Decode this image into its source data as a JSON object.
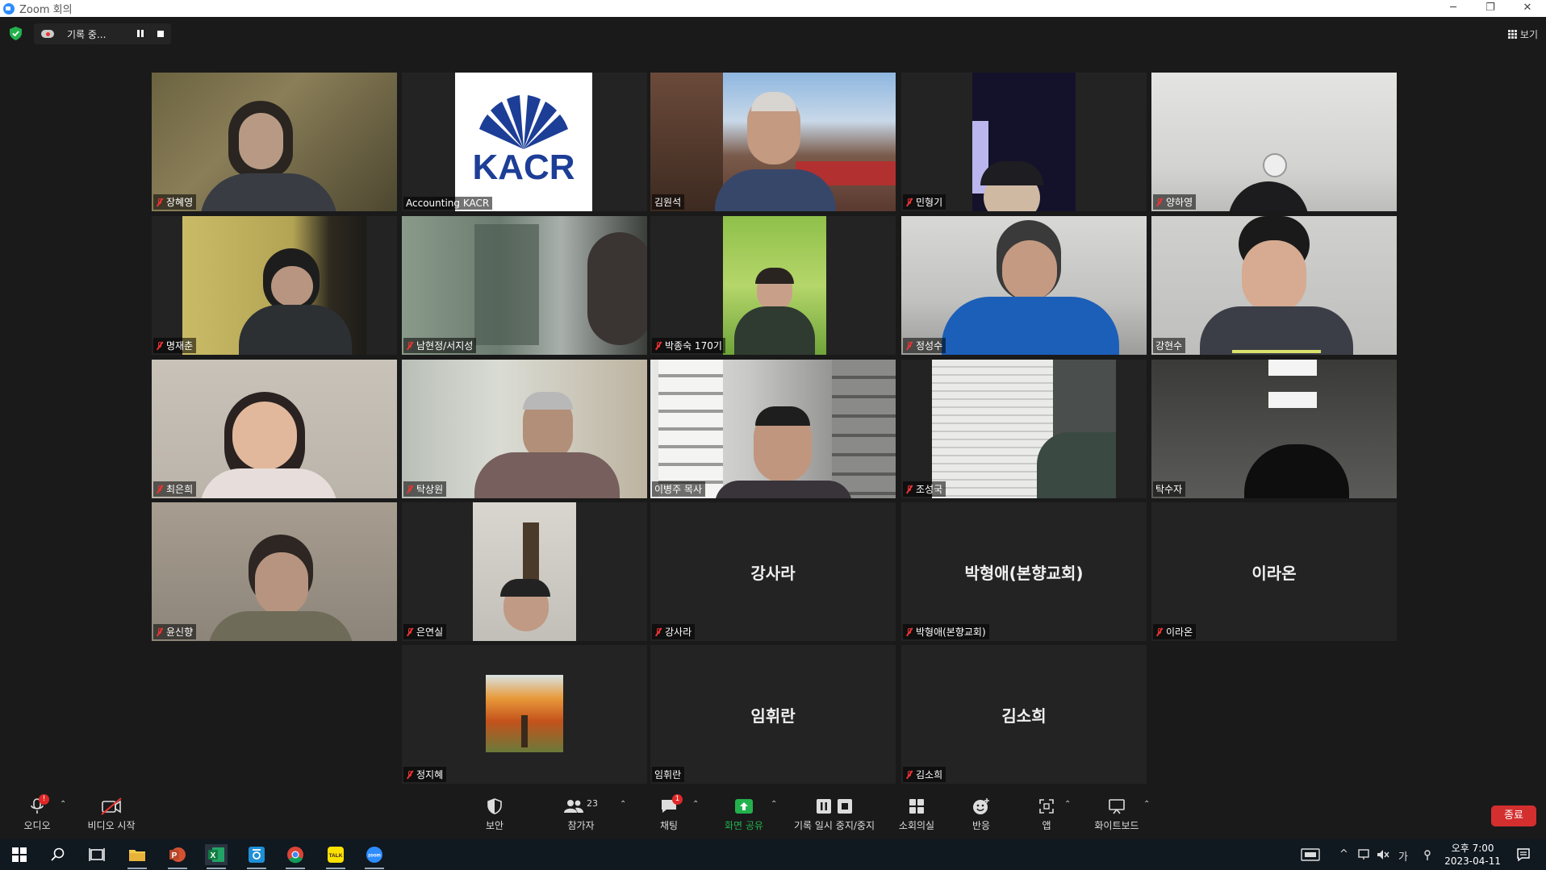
{
  "window": {
    "title": "Zoom 회의",
    "min": "─",
    "restore": "❐",
    "close": "✕"
  },
  "topbar": {
    "recording_label": "기록 중...",
    "view_label": "보기"
  },
  "participants": [
    {
      "name": "장혜영",
      "muted": true
    },
    {
      "name": "Accounting KACR",
      "muted": false,
      "logo_text": "KACR"
    },
    {
      "name": "김원석",
      "muted": false,
      "active_speaker": true
    },
    {
      "name": "민형기",
      "muted": true
    },
    {
      "name": "양하영",
      "muted": true
    },
    {
      "name": "명재춘",
      "muted": true
    },
    {
      "name": "남현정/서지성",
      "muted": true
    },
    {
      "name": "박종숙 170기",
      "muted": true
    },
    {
      "name": "정성수",
      "muted": true
    },
    {
      "name": "강현수",
      "muted": false
    },
    {
      "name": "최은희",
      "muted": true
    },
    {
      "name": "탁상원",
      "muted": true
    },
    {
      "name": "이병주 목사",
      "muted": false
    },
    {
      "name": "조성국",
      "muted": true
    },
    {
      "name": "탁수자",
      "muted": false
    },
    {
      "name": "윤신향",
      "muted": true
    },
    {
      "name": "은연실",
      "muted": true
    },
    {
      "name": "강사라",
      "muted": true,
      "center_name": "강사라"
    },
    {
      "name": "박형애(본향교회)",
      "muted": true,
      "center_name": "박형애(본향교회)"
    },
    {
      "name": "이라온",
      "muted": true,
      "center_name": "이라온"
    },
    {
      "name": "정지혜",
      "muted": true
    },
    {
      "name": "임휘란",
      "muted": false,
      "center_name": "임휘란"
    },
    {
      "name": "김소희",
      "muted": true,
      "center_name": "김소희"
    }
  ],
  "toolbar": {
    "audio": "오디오",
    "audio_badge": "!",
    "video": "비디오 시작",
    "security": "보안",
    "participants": "참가자",
    "participants_count": "23",
    "chat": "채팅",
    "chat_badge": "1",
    "share": "화면 공유",
    "pause_stop": "기록 일시 중지/중지",
    "breakout": "소회의실",
    "reactions": "반응",
    "apps": "앱",
    "whiteboard": "화이트보드",
    "end": "종료"
  },
  "taskbar": {
    "time": "오후 7:00",
    "date": "2023-04-11",
    "ime": "가",
    "kakao_label": "TALK",
    "zoom_label": "zoom"
  },
  "colors": {
    "active_border": "#d9e26a",
    "share_green": "#23b14d",
    "end_red": "#d32f2f",
    "mute_red": "#e33333"
  }
}
